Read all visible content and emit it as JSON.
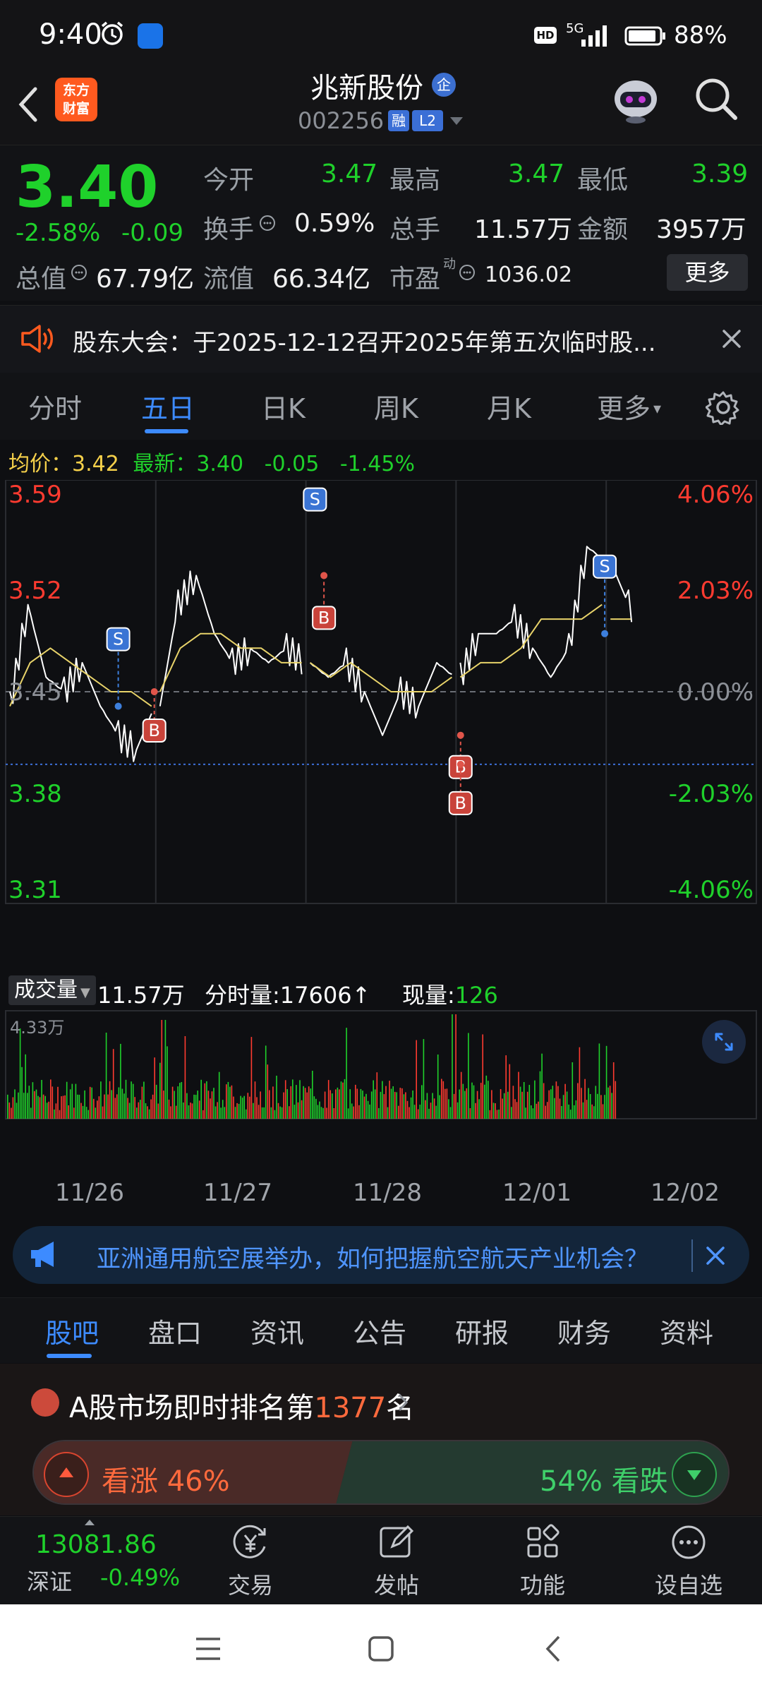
{
  "status_bar": {
    "time": "9:40",
    "network": "5G",
    "battery": "88%",
    "hd": "HD"
  },
  "header": {
    "app_logo": "东方\n财富",
    "stock_name": "兆新股份",
    "badge_qi": "企",
    "stock_code": "002256",
    "badge_rong": "融",
    "badge_l2": "L2"
  },
  "quote": {
    "price": "3.40",
    "change_pct": "-2.58%",
    "change": "-0.09",
    "open_label": "今开",
    "open": "3.47",
    "high_label": "最高",
    "high": "3.47",
    "low_label": "最低",
    "low": "3.39",
    "turnover_label": "换手",
    "turnover": "0.59%",
    "volume_label": "总手",
    "volume": "11.57万",
    "amount_label": "金额",
    "amount": "3957万",
    "mktcap_label": "总值",
    "mktcap": "67.79亿",
    "float_label": "流值",
    "float_cap": "66.34亿",
    "pe_label": "市盈",
    "pe_sup": "动",
    "pe": "1036.02",
    "more_label": "更多"
  },
  "notice": {
    "text": "股东大会：于2025-12-12召开2025年第五次临时股..."
  },
  "chart_tabs": [
    "分时",
    "五日",
    "日K",
    "周K",
    "月K",
    "更多"
  ],
  "chart_info": {
    "avg_label": "均价：",
    "avg": "3.42",
    "latest_label": "最新：",
    "latest": "3.40",
    "chg": "-0.05",
    "pct": "-1.45%"
  },
  "chart_data": {
    "type": "line",
    "title": "",
    "price_axis": [
      "3.59",
      "3.52",
      "3.45",
      "3.38",
      "3.31"
    ],
    "pct_axis": [
      "4.06%",
      "2.03%",
      "0.00%",
      "-2.03%",
      "-4.06%"
    ],
    "prev_close": 3.45,
    "ylim": [
      3.31,
      3.59
    ],
    "days": [
      "11/26",
      "11/27",
      "11/28",
      "12/01",
      "12/02"
    ],
    "series": [
      {
        "values": [
          3.44,
          3.51,
          3.46,
          3.45,
          3.47,
          3.44,
          3.42,
          3.41,
          3.44,
          3.51,
          3.53,
          3.49,
          3.47,
          3.48,
          3.47,
          3.48,
          3.47,
          3.46,
          3.47,
          3.45,
          3.42,
          3.45,
          3.44,
          3.47,
          3.46,
          3.49,
          3.49,
          3.5,
          3.48,
          3.46,
          3.48,
          3.55,
          3.54,
          3.51,
          3.5,
          3.5,
          3.49,
          3.49,
          3.42,
          3.47
        ]
      },
      {
        "values": [
          3.44,
          3.47,
          3.48,
          3.47,
          3.46,
          3.45,
          3.45,
          3.44,
          3.45,
          3.48,
          3.49,
          3.49,
          3.48,
          3.48,
          3.47,
          3.47,
          3.47,
          3.46,
          3.47,
          3.46,
          3.45,
          3.45,
          3.45,
          3.46,
          3.46,
          3.47,
          3.47,
          3.48,
          3.5,
          3.5,
          3.5,
          3.51,
          3.5,
          3.5,
          3.5,
          3.5,
          3.49,
          3.49,
          3.48,
          3.47
        ]
      }
    ],
    "trade_marks": [
      {
        "type": "S",
        "day": "11/26",
        "price": 3.44
      },
      {
        "type": "B",
        "day": "11/26",
        "price": 3.45
      },
      {
        "type": "S",
        "day": "11/28",
        "price": 3.58
      },
      {
        "type": "B",
        "day": "11/28",
        "price": 3.53
      },
      {
        "type": "S",
        "day": "12/01",
        "price": 3.49
      },
      {
        "type": "B",
        "day": "12/01",
        "price": 3.42
      },
      {
        "type": "B",
        "day": "12/01",
        "price": 3.4
      }
    ],
    "volume": {
      "label": "成交量",
      "total": "11.57万",
      "max_label": "4.33万"
    }
  },
  "volume_header": {
    "fenshi_label": "分时量:",
    "fenshi": "17606",
    "fenshi_arrow": "↑",
    "xianliang_label": "现量:",
    "xianliang": "126"
  },
  "ad": {
    "text": "亚洲通用航空展举办，如何把握航空航天产业机会？"
  },
  "lower_tabs": [
    "股吧",
    "盘口",
    "资讯",
    "公告",
    "研报",
    "财务",
    "资料"
  ],
  "ranking": {
    "prefix": "A股市场即时排名第",
    "rank": "1377",
    "suffix": "名"
  },
  "sentiment": {
    "up_label": "看涨 46%",
    "down_label": "54% 看跌"
  },
  "toolbar": {
    "index_value": "13081.86",
    "index_name": "深证",
    "index_pct": "-0.49%",
    "items": [
      "交易",
      "发帖",
      "功能",
      "设自选"
    ]
  },
  "colors": {
    "up": "#ff3b30",
    "down": "#1fd12b",
    "accent": "#3d8bff",
    "price_line": "#ffffff",
    "avg_line": "#e8d36a"
  }
}
